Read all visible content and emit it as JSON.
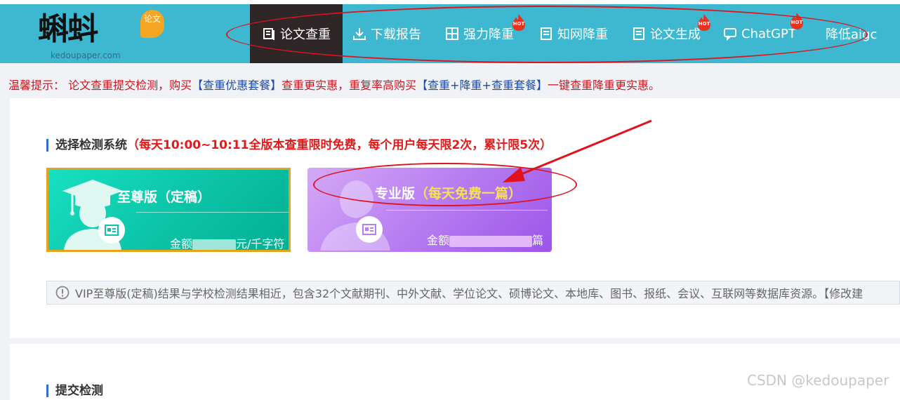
{
  "header": {
    "logo": {
      "text": "蝌蚪",
      "badge": "论文",
      "subtext": "kedoupaper.com"
    },
    "nav": [
      {
        "label": "论文查重",
        "icon": "book-icon",
        "active": true,
        "hot": false
      },
      {
        "label": "下载报告",
        "icon": "download-icon",
        "active": false,
        "hot": false
      },
      {
        "label": "强力降重",
        "icon": "grid-icon",
        "active": false,
        "hot": true
      },
      {
        "label": "知网降重",
        "icon": "document-icon",
        "active": false,
        "hot": false
      },
      {
        "label": "论文生成",
        "icon": "document-icon",
        "active": false,
        "hot": true
      },
      {
        "label": "ChatGPT",
        "icon": "chat-icon",
        "active": false,
        "hot": true
      },
      {
        "label": "降低aigc",
        "icon": "",
        "active": false,
        "hot": false
      }
    ],
    "hot_label": "HOT"
  },
  "notice": {
    "prefix": "温馨提示： 论文查重提交检测，购买",
    "link1": "【查重优惠套餐】",
    "middle": "查重更实惠，重复率高购买",
    "link2": "【查重+降重+查重套餐】",
    "suffix": "一键查重降重更实惠。"
  },
  "section": {
    "title": "选择检测系统",
    "promo": "（每天10:00~10:11全版本查重限时免费，每个用户每天限2次，累计限5次）"
  },
  "cards": [
    {
      "title": "至尊版（定稿）",
      "price_prefix": "金额",
      "price_suffix": "元/千字符",
      "selected": true
    },
    {
      "title": "专业版",
      "highlight": "（每天免费一篇）",
      "price_prefix": "金额",
      "price_suffix": "篇",
      "selected": false
    }
  ],
  "info": "VIP至尊版(定稿)结果与学校检测结果相近，包含32个文献期刊、中外文献、学位论文、硕博论文、本地库、图书、报纸、会议、互联网等数据库资源。【修改建",
  "section2": {
    "title": "提交检测"
  },
  "watermark": "CSDN @kedoupaper",
  "colors": {
    "nav_bg": "#3eb7d0",
    "active_nav": "#2f2628",
    "alert_red": "#d0121b",
    "link_blue": "#1c4ca8",
    "annotation_red": "#e2121c"
  }
}
